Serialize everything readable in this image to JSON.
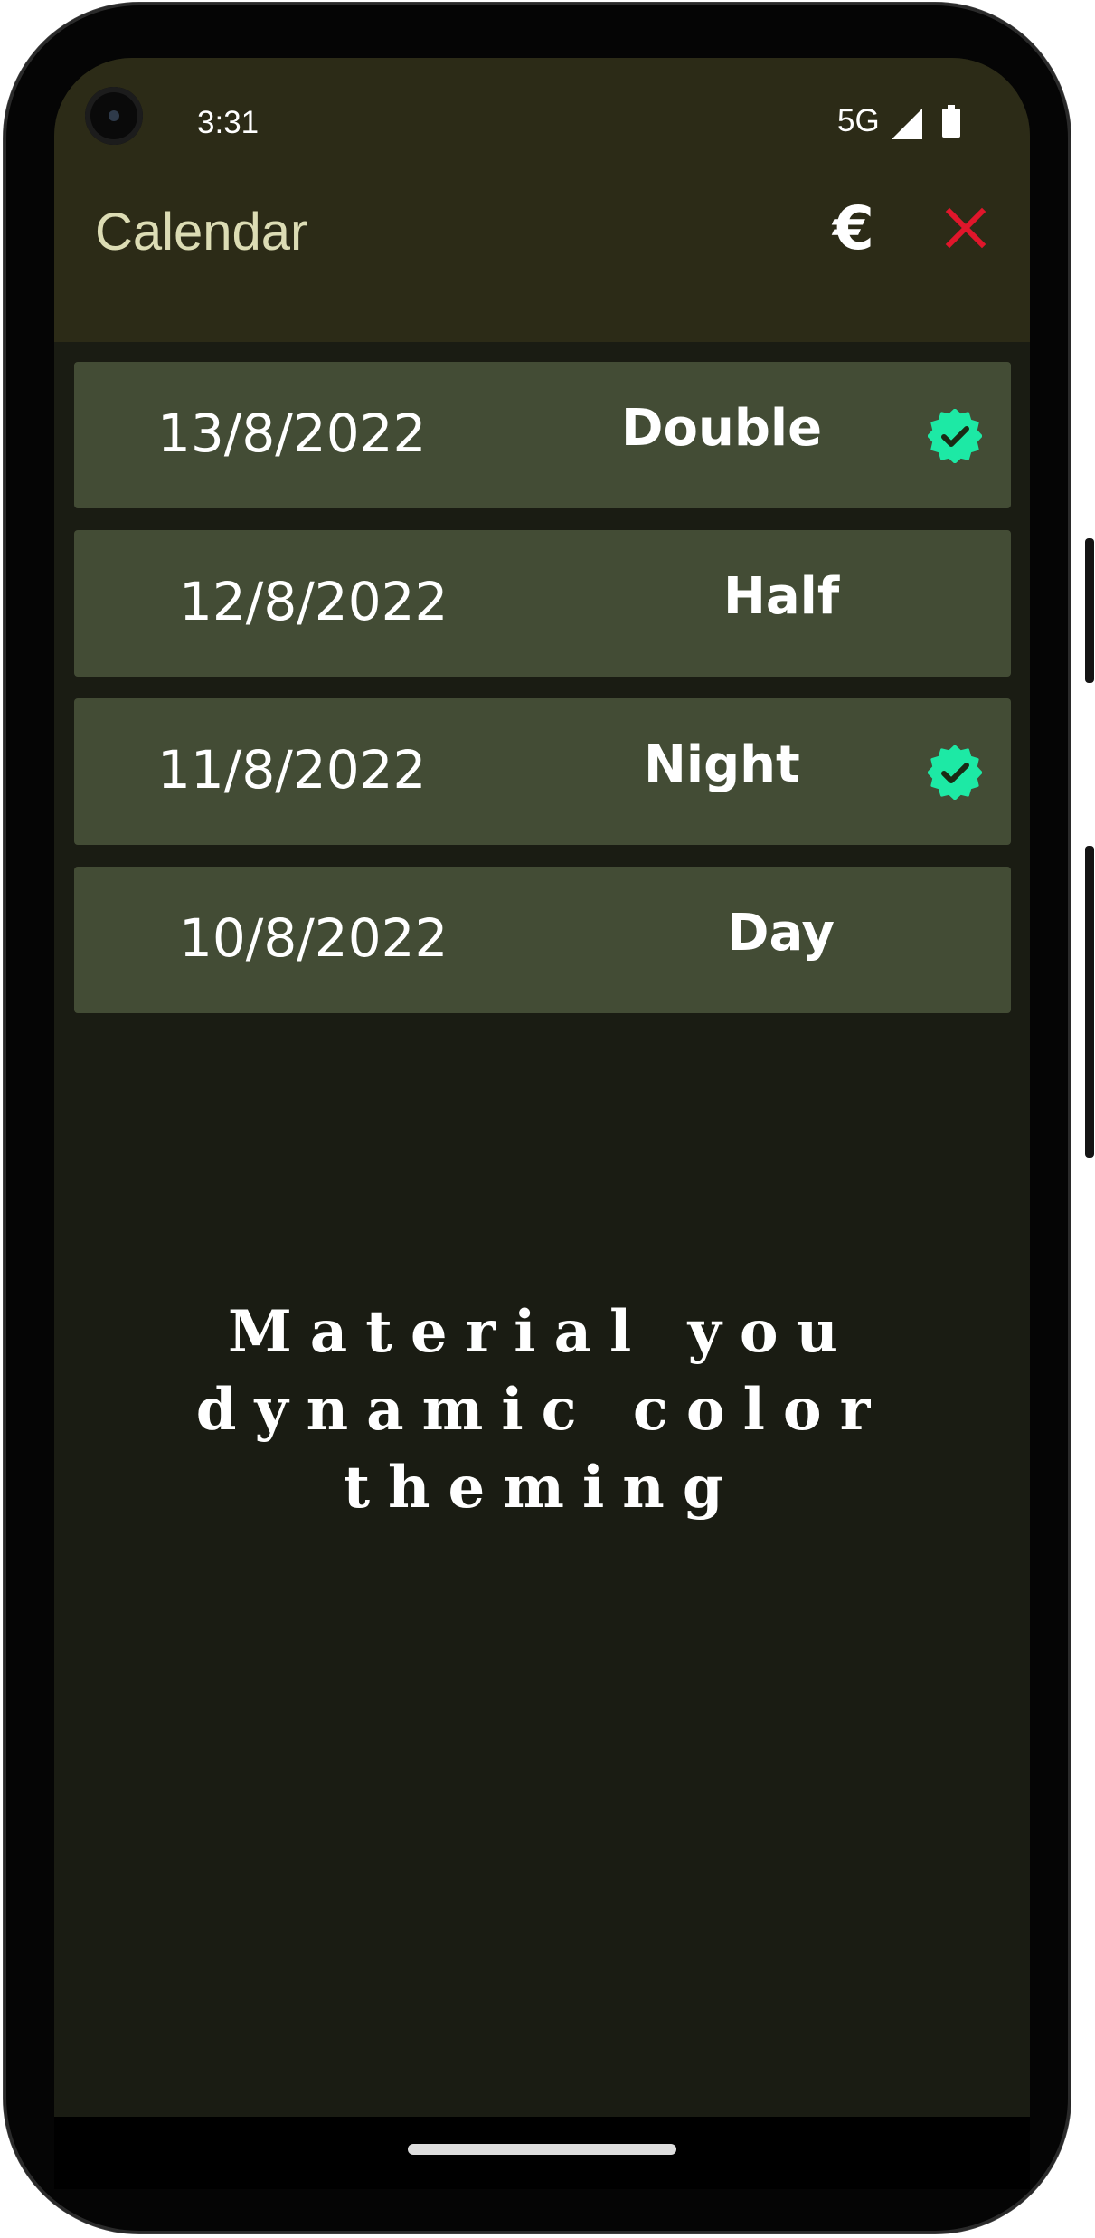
{
  "status_bar": {
    "time": "3:31",
    "network": "5G",
    "icons": [
      "signal-icon",
      "battery-icon"
    ]
  },
  "app_bar": {
    "title": "Calendar",
    "euro_label": "€",
    "actions": [
      "euro-icon",
      "close-icon"
    ],
    "close_color": "#e0162b"
  },
  "entries": [
    {
      "date": "13/8/2022",
      "type": "Double",
      "verified": true
    },
    {
      "date": "12/8/2022",
      "type": "Half",
      "verified": false
    },
    {
      "date": "11/8/2022",
      "type": "Night",
      "verified": true
    },
    {
      "date": "10/8/2022",
      "type": "Day",
      "verified": false
    }
  ],
  "tagline": {
    "line1": "Material you",
    "line2": "dynamic color theming"
  },
  "colors": {
    "background": "#1a1c13",
    "app_bar": "#2c2b17",
    "row": "#434c35",
    "verified": "#1de9a5",
    "title_text": "#dcdcb4"
  }
}
